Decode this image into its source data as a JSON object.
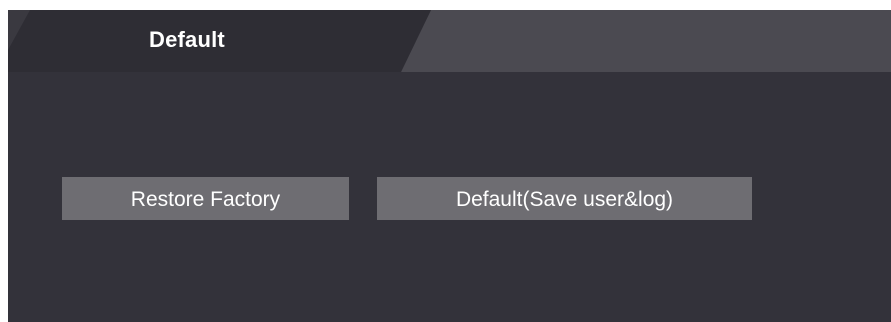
{
  "tabs": [
    {
      "label": "Default",
      "active": true
    }
  ],
  "actions": {
    "restore_factory_label": "Restore Factory",
    "default_save_label": "Default(Save user&log)"
  },
  "colors": {
    "panel_background": "#33323a",
    "active_tab": "#2f2e35",
    "inactive_tab_area": "#4a4950",
    "button_background": "#6e6d72",
    "text": "#ffffff"
  }
}
